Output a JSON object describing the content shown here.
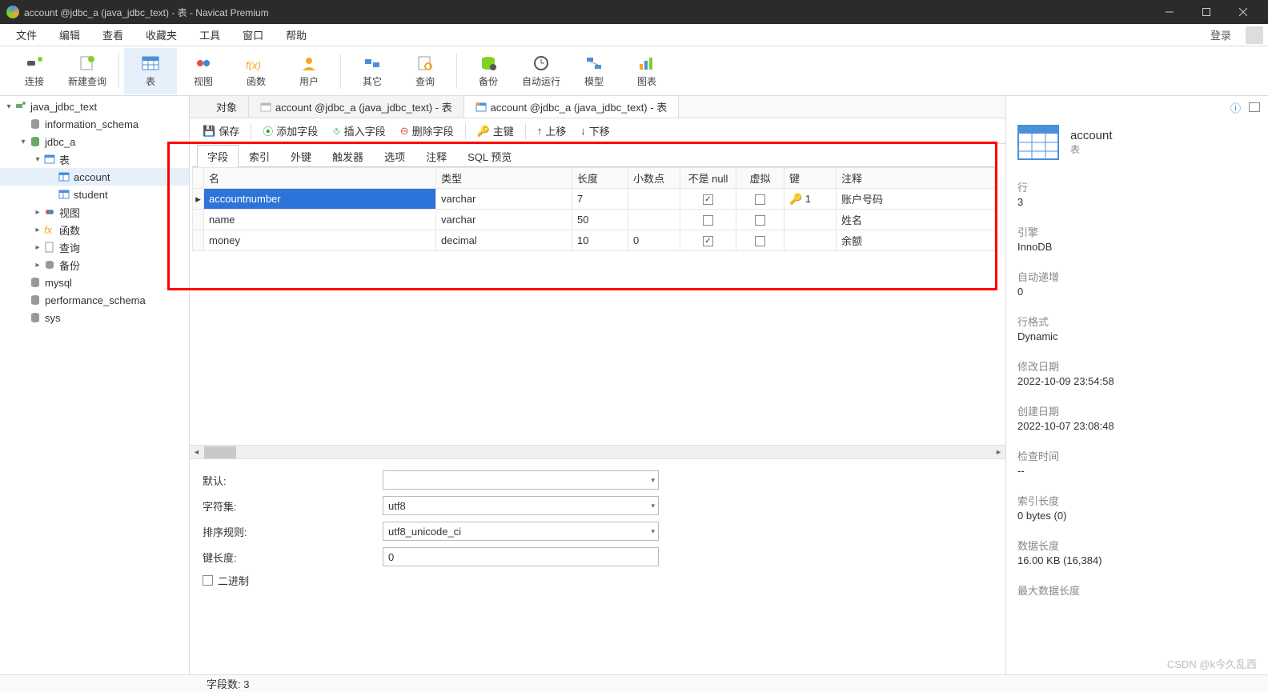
{
  "title": "account @jdbc_a (java_jdbc_text) - 表 - Navicat Premium",
  "menu": [
    "文件",
    "编辑",
    "查看",
    "收藏夹",
    "工具",
    "窗口",
    "帮助"
  ],
  "login": "登录",
  "toolbar": [
    {
      "k": "connect",
      "l": "连接"
    },
    {
      "k": "newquery",
      "l": "新建查询"
    },
    {
      "k": "table",
      "l": "表",
      "active": true
    },
    {
      "k": "view",
      "l": "视图"
    },
    {
      "k": "func",
      "l": "函数"
    },
    {
      "k": "user",
      "l": "用户"
    },
    {
      "k": "other",
      "l": "其它"
    },
    {
      "k": "query",
      "l": "查询"
    },
    {
      "k": "backup",
      "l": "备份"
    },
    {
      "k": "auto",
      "l": "自动运行"
    },
    {
      "k": "model",
      "l": "模型"
    },
    {
      "k": "chart",
      "l": "图表"
    }
  ],
  "tree": [
    {
      "d": 0,
      "tw": "v",
      "ico": "conn",
      "l": "java_jdbc_text"
    },
    {
      "d": 1,
      "tw": "",
      "ico": "db",
      "l": "information_schema"
    },
    {
      "d": 1,
      "tw": "v",
      "ico": "dbopen",
      "l": "jdbc_a"
    },
    {
      "d": 2,
      "tw": "v",
      "ico": "tables",
      "l": "表"
    },
    {
      "d": 3,
      "tw": "",
      "ico": "table",
      "l": "account",
      "sel": true
    },
    {
      "d": 3,
      "tw": "",
      "ico": "table",
      "l": "student"
    },
    {
      "d": 2,
      "tw": ">",
      "ico": "views",
      "l": "视图"
    },
    {
      "d": 2,
      "tw": ">",
      "ico": "fx",
      "l": "函数"
    },
    {
      "d": 2,
      "tw": ">",
      "ico": "query",
      "l": "查询"
    },
    {
      "d": 2,
      "tw": ">",
      "ico": "backup",
      "l": "备份"
    },
    {
      "d": 1,
      "tw": "",
      "ico": "db",
      "l": "mysql"
    },
    {
      "d": 1,
      "tw": "",
      "ico": "db",
      "l": "performance_schema"
    },
    {
      "d": 1,
      "tw": "",
      "ico": "db",
      "l": "sys"
    }
  ],
  "tabs": [
    {
      "l": "对象"
    },
    {
      "l": "account @jdbc_a (java_jdbc_text) - 表"
    },
    {
      "l": "account @jdbc_a (java_jdbc_text) - 表",
      "active": true
    }
  ],
  "actions": {
    "save": "保存",
    "add": "添加字段",
    "insert": "插入字段",
    "delete": "删除字段",
    "pk": "主键",
    "up": "上移",
    "down": "下移"
  },
  "subtabs": [
    "字段",
    "索引",
    "外键",
    "触发器",
    "选项",
    "注释",
    "SQL 预览"
  ],
  "cols": {
    "name": "名",
    "type": "类型",
    "len": "长度",
    "dec": "小数点",
    "notnull": "不是 null",
    "virtual": "虚拟",
    "key": "键",
    "comment": "注释"
  },
  "rows": [
    {
      "name": "accountnumber",
      "type": "varchar",
      "len": "7",
      "dec": "",
      "nn": true,
      "v": false,
      "key": "1",
      "comment": "账户号码",
      "sel": true
    },
    {
      "name": "name",
      "type": "varchar",
      "len": "50",
      "dec": "",
      "nn": false,
      "v": false,
      "key": "",
      "comment": "姓名"
    },
    {
      "name": "money",
      "type": "decimal",
      "len": "10",
      "dec": "0",
      "nn": true,
      "v": false,
      "key": "",
      "comment": "余额"
    }
  ],
  "props": {
    "default_l": "默认:",
    "default_v": "",
    "charset_l": "字符集:",
    "charset_v": "utf8",
    "collation_l": "排序规则:",
    "collation_v": "utf8_unicode_ci",
    "keylen_l": "键长度:",
    "keylen_v": "0",
    "binary_l": "二进制"
  },
  "right": {
    "title": "account",
    "sub": "表",
    "items": [
      {
        "k": "行",
        "v": "3"
      },
      {
        "k": "引擎",
        "v": "InnoDB"
      },
      {
        "k": "自动递增",
        "v": "0"
      },
      {
        "k": "行格式",
        "v": "Dynamic"
      },
      {
        "k": "修改日期",
        "v": "2022-10-09 23:54:58"
      },
      {
        "k": "创建日期",
        "v": "2022-10-07 23:08:48"
      },
      {
        "k": "检查时间",
        "v": "--"
      },
      {
        "k": "索引长度",
        "v": "0 bytes (0)"
      },
      {
        "k": "数据长度",
        "v": "16.00 KB (16,384)"
      },
      {
        "k": "最大数据长度",
        "v": ""
      }
    ]
  },
  "status": "字段数: 3",
  "watermark": "CSDN @k今久乱西"
}
